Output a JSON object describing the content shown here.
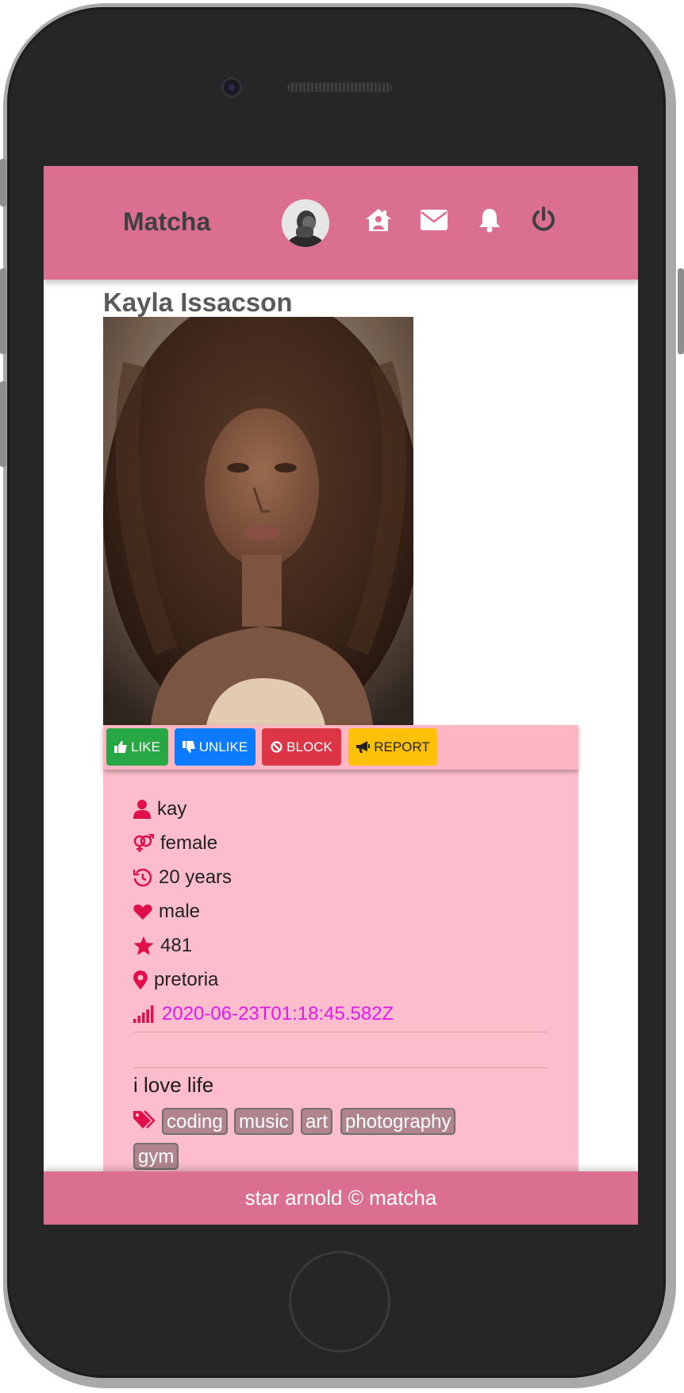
{
  "nav": {
    "brand": "Matcha",
    "avatar_icon": "user-avatar",
    "icons": [
      "home-icon",
      "envelope-icon",
      "bell-icon",
      "power-icon"
    ]
  },
  "profile": {
    "name": "Kayla Issacson",
    "photo": "profile-photo"
  },
  "actions": {
    "like": "LIKE",
    "unlike": "UNLIKE",
    "block": "BLOCK",
    "report": "REPORT"
  },
  "details": {
    "username": "kay",
    "gender": "female",
    "age": "20 years",
    "preference": "male",
    "rating": "481",
    "location": "pretoria",
    "last_seen": "2020-06-23T01:18:45.582Z",
    "bio": "i love life",
    "tags": [
      "coding",
      "music",
      "art",
      "photography",
      "gym"
    ]
  },
  "colors": {
    "brand_pink": "#db6f90",
    "card_pink": "#fdbdcc",
    "icon_red": "#e0104a",
    "status_magenta": "#e21ae6"
  },
  "footer": {
    "text": "star arnold © matcha"
  }
}
